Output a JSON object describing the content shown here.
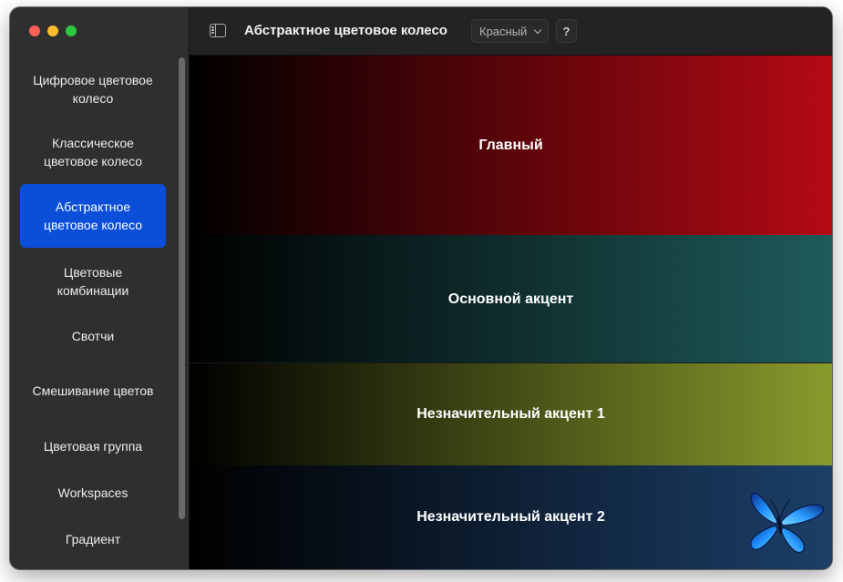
{
  "window": {
    "title": "Абстрактное цветовое колесо",
    "color_select": "Красный",
    "help_label": "?"
  },
  "sidebar": {
    "items": [
      {
        "label": "Цифровое цветовое колесо",
        "active": false
      },
      {
        "label": "Классическое цветовое колесо",
        "active": false
      },
      {
        "label": "Абстрактное цветовое колесо",
        "active": true
      },
      {
        "label": "Цветовые комбинации",
        "active": false
      },
      {
        "label": "Свотчи",
        "active": false
      },
      {
        "label": "Смешивание цветов",
        "active": false
      },
      {
        "label": "Цветовая группа",
        "active": false
      },
      {
        "label": "Workspaces",
        "active": false
      },
      {
        "label": "Градиент",
        "active": false
      }
    ]
  },
  "bands": [
    {
      "label": "Главный",
      "color": "#b50a14"
    },
    {
      "label": "Основной акцент",
      "color": "#1f5b5b"
    },
    {
      "label": "Незначительный акцент 1",
      "color": "#8a9a2c"
    },
    {
      "label": "Незначительный акцент 2",
      "color": "#1c3f68"
    }
  ],
  "colors": {
    "accent": "#0b4fd9",
    "sidebar_bg": "#2f2f2f",
    "toolbar_bg": "#232323"
  },
  "icons": [
    "sidebar-toggle-icon",
    "chevron-down-icon",
    "butterfly-icon"
  ]
}
